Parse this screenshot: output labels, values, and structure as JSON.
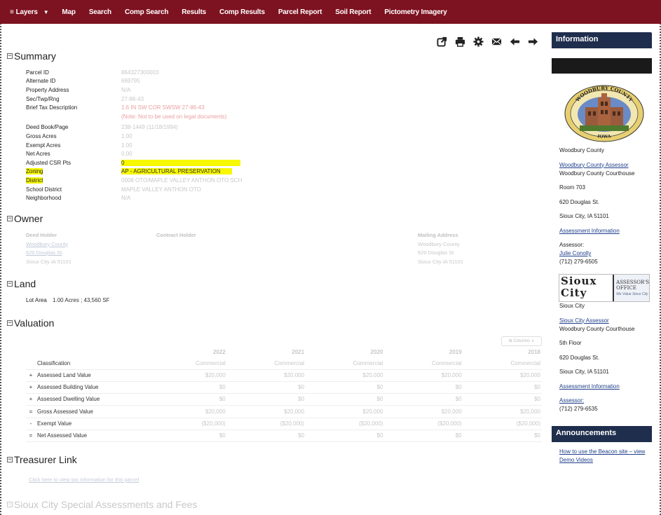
{
  "nav": {
    "items": [
      "Layers",
      "Map",
      "Search",
      "Comp Search",
      "Results",
      "Comp Results",
      "Parcel Report",
      "Soil Report",
      "Pictometry Imagery"
    ]
  },
  "summary": {
    "title": "Summary",
    "rows": [
      {
        "label": "Parcel ID",
        "value": "864327300003"
      },
      {
        "label": "Alternate ID",
        "value": "669795"
      },
      {
        "label": "Property Address",
        "value": "N/A"
      },
      {
        "label": "Sec/Twp/Rng",
        "value": "27-86-43"
      },
      {
        "label": "Brief Tax Description",
        "value": "1.6 IN SW COR SWSW 27-86-43"
      },
      {
        "label": "",
        "value": "(Note: Not to be used on legal documents)"
      },
      {
        "label": "Deed Book/Page",
        "value": "238-1449 (11/18/1994)"
      },
      {
        "label": "Gross Acres",
        "value": "1.00"
      },
      {
        "label": "Exempt Acres",
        "value": "1.00"
      },
      {
        "label": "Net Acres",
        "value": "0.00"
      },
      {
        "label": "Adjusted CSR Pts",
        "value": "0"
      },
      {
        "label": "Zoning",
        "value": "AP - AGRICULTURAL PRESERVATION"
      },
      {
        "label": "District",
        "value": "0008 OTO/MAPLE VALLEY ANTHON OTO SCH"
      },
      {
        "label": "School District",
        "value": "MAPLE VALLEY ANTHON OTO"
      },
      {
        "label": "Neighborhood",
        "value": "N/A"
      }
    ]
  },
  "owner": {
    "title": "Owner",
    "deed_holder_header": "Deed Holder",
    "deed_holder": [
      "Woodbury County",
      "620 Douglas St",
      "Sioux City IA 51101"
    ],
    "contract_holder_header": "Contract Holder",
    "mailing_header": "Mailing Address",
    "mailing": [
      "Woodbury County",
      "620 Douglas St",
      "Sioux City IA 51101"
    ]
  },
  "land": {
    "title": "Land",
    "label": "Lot Area",
    "value": "1.00 Acres ; 43,560 SF"
  },
  "valuation": {
    "title": "Valuation",
    "columns_btn": "⊞ Columns ∨",
    "years": [
      "2022",
      "2021",
      "2020",
      "2019",
      "2018"
    ],
    "classification_label": "Classification",
    "classification": [
      "Commercial",
      "Commercial",
      "Commercial",
      "Commercial",
      "Commercial"
    ],
    "rows": [
      {
        "op": "+",
        "label": "Assessed Land Value",
        "values": [
          "$20,000",
          "$20,000",
          "$20,000",
          "$20,000",
          "$20,000"
        ]
      },
      {
        "op": "+",
        "label": "Assessed Building Value",
        "values": [
          "$0",
          "$0",
          "$0",
          "$0",
          "$0"
        ]
      },
      {
        "op": "+",
        "label": "Assessed Dwelling Value",
        "values": [
          "$0",
          "$0",
          "$0",
          "$0",
          "$0"
        ]
      },
      {
        "op": "=",
        "label": "Gross Assessed Value",
        "values": [
          "$20,000",
          "$20,000",
          "$20,000",
          "$20,000",
          "$20,000"
        ]
      },
      {
        "op": "-",
        "label": "Exempt Value",
        "values": [
          "($20,000)",
          "($20,000)",
          "($20,000)",
          "($20,000)",
          "($20,000)"
        ]
      },
      {
        "op": "=",
        "label": "Net Assessed Value",
        "values": [
          "$0",
          "$0",
          "$0",
          "$0",
          "$0"
        ]
      }
    ]
  },
  "treasurer": {
    "title": "Treasurer Link",
    "link": "Click here to view tax information for this parcel"
  },
  "special": {
    "title": "Sioux City Special Assessments and Fees"
  },
  "sidebar": {
    "info_title": "Information",
    "seal_top": "WOODBURY COUNTY",
    "seal_bottom": "IOWA",
    "county_name": "Woodbury County",
    "county_assessor_link": "Woodbury County Assessor",
    "county_lines": [
      "Woodbury County Courthouse",
      "Room 703",
      "620 Douglas St.",
      "Sioux City, IA 51101"
    ],
    "county_assessment_link": "Assessment Information",
    "county_assessor_label": "Assessor:",
    "county_assessor_name": "Julie Conolly",
    "county_phone": "(712) 279-6505",
    "sc_logo_left": "Sioux City",
    "sc_logo_right": "ASSESSOR'S OFFICE",
    "sc_logo_tag": "We Value Sioux City",
    "city_name": "Sioux City",
    "city_assessor_link": "Sioux City Assessor",
    "city_lines": [
      "Woodbury County Courthouse",
      "5th Floor",
      "620 Douglas St.",
      "Sioux City, IA 51101"
    ],
    "city_assessment_link": "Assessment Information",
    "city_assessor_label": "Assessor:",
    "city_phone": "(712) 279-6535",
    "announcements_title": "Announcements",
    "announcement_link": "How to use the Beacon site – view Demo Videos"
  },
  "colors": {
    "nav_bg": "#7d1220",
    "sidebar_head": "#1f2e4d",
    "highlight": "#f7f700"
  }
}
